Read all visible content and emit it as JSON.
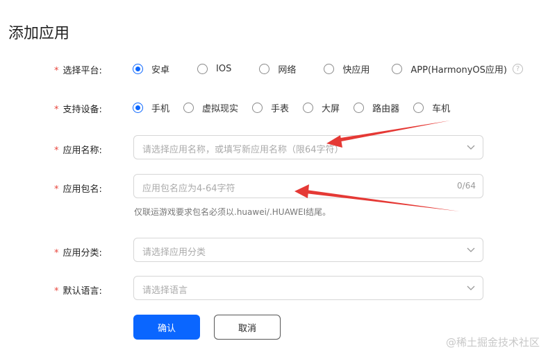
{
  "page": {
    "title": "添加应用"
  },
  "form": {
    "platform": {
      "label": "选择平台:",
      "options": [
        "安卓",
        "IOS",
        "网络",
        "快应用",
        "APP(HarmonyOS应用)"
      ],
      "selected": 0
    },
    "device": {
      "label": "支持设备:",
      "options": [
        "手机",
        "虚拟现实",
        "手表",
        "大屏",
        "路由器",
        "车机"
      ],
      "selected": 0
    },
    "app_name": {
      "label": "应用名称:",
      "placeholder": "请选择应用名称，或填写新应用名称（限64字符）"
    },
    "package_name": {
      "label": "应用包名:",
      "placeholder": "应用包名应为4-64字符",
      "counter": "0/64",
      "hint": "仅联运游戏要求包名必须以.huawei/.HUAWEI结尾。"
    },
    "category": {
      "label": "应用分类:",
      "placeholder": "请选择应用分类"
    },
    "language": {
      "label": "默认语言:",
      "placeholder": "请选择语言"
    },
    "required_mark": "*"
  },
  "buttons": {
    "confirm": "确认",
    "cancel": "取消"
  },
  "watermark": "@稀土掘金技术社区",
  "colors": {
    "primary": "#0a66ff",
    "required": "#e8453c",
    "annotation_arrow": "#e53935"
  },
  "icons": {
    "help": "question-circle",
    "select": "chevron-down"
  }
}
